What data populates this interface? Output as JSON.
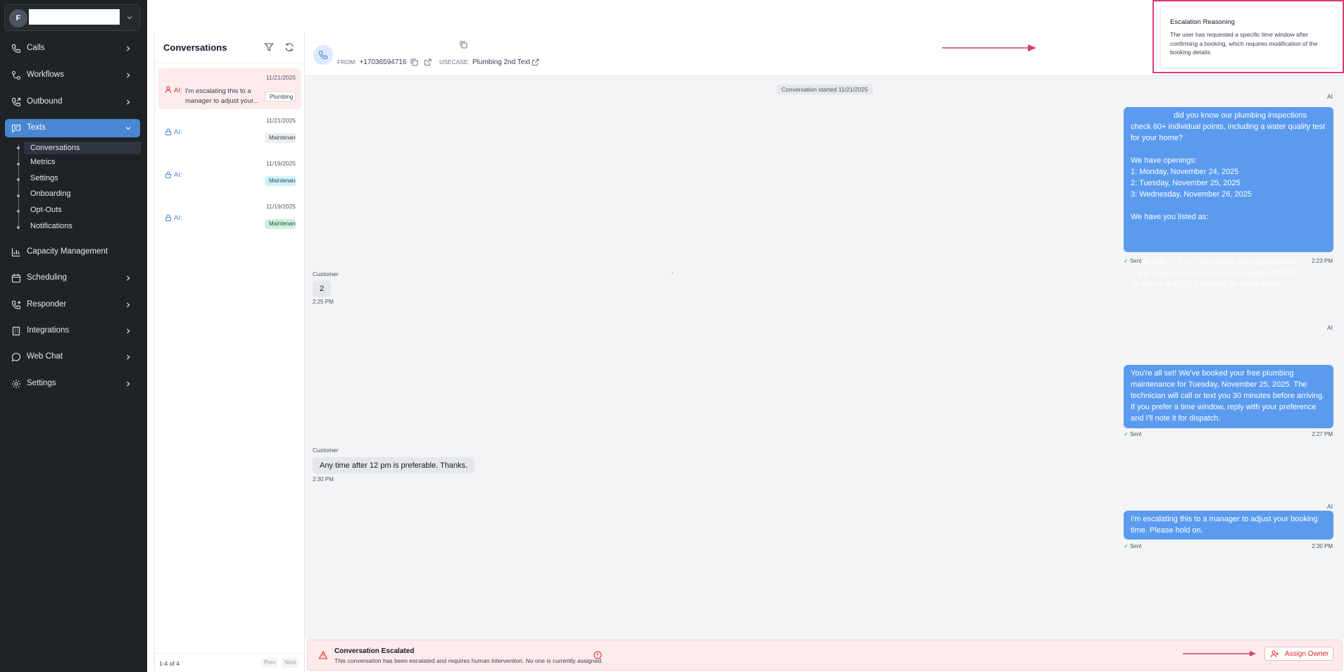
{
  "colors": {
    "sidebar_bg": "#1f2327",
    "accent": "#4a86d4",
    "ai_bubble": "#5b9bef",
    "escalation_bg": "#fdebec",
    "danger": "#dc2626",
    "annotation": "#d63b7a"
  },
  "org": {
    "initial": "F"
  },
  "nav": {
    "calls": "Calls",
    "workflows": "Workflows",
    "outbound": "Outbound",
    "texts": "Texts",
    "capacity": "Capacity Management",
    "scheduling": "Scheduling",
    "responder": "Responder",
    "integrations": "Integrations",
    "webchat": "Web Chat",
    "settings": "Settings"
  },
  "texts_sub": {
    "conversations": "Conversations",
    "metrics": "Metrics",
    "settings": "Settings",
    "onboarding": "Onboarding",
    "optouts": "Opt-Outs",
    "notifications": "Notifications"
  },
  "conversations": {
    "title": "Conversations",
    "items": [
      {
        "date": "11/21/2025",
        "ai": "AI:",
        "preview": "I'm escalating this to a manager to adjust your...",
        "tag": "Plumbing"
      },
      {
        "date": "11/21/2025",
        "ai": "AI:",
        "preview": "",
        "tag": "Maintenance"
      },
      {
        "date": "11/19/2025",
        "ai": "AI:",
        "preview": "",
        "tag": "Maintenance"
      },
      {
        "date": "11/19/2025",
        "ai": "AI:",
        "preview": "",
        "tag": "Maintenance"
      }
    ],
    "count": "1-4 of 4",
    "prev": "Prev",
    "next": "Next"
  },
  "header": {
    "from_label": "FROM:",
    "from_value": "+17036594716",
    "usecase_label": "USECASE:",
    "usecase_value": "Plumbing 2nd Text"
  },
  "chat": {
    "started": "Conversation started 11/21/2025",
    "messages": [
      {
        "sender": "AI",
        "text": "                    did you know our plumbing inspections check 60+ individual points, including a water quality test for your home?\n\nWe have openings:\n1: Monday, November 24, 2025\n2: Tuesday, November 25, 2025\n3: Wednesday, November 26, 2025\n\nWe have you listed as:\n\n\n\nReply with 1, 2, or 3 to confirm your appointment.\nIf any of your info is incorrect, just reply UPDATE.\nOr call us at (571) 240-6620 for other times.",
        "status": "Sent",
        "time": "2:23 PM"
      },
      {
        "sender": "Customer",
        "text": "2",
        "time": "2:25 PM"
      },
      {
        "sender": "AI",
        "text": "You're all set! We've booked your free plumbing maintenance for Tuesday, November 25, 2025. The technician will call or text you 30 minutes before arriving. If you prefer a time window, reply with your preference and I'll note it for dispatch.",
        "status": "Sent",
        "time": "2:27 PM"
      },
      {
        "sender": "Customer",
        "text": "Any time after 12 pm is preferable. Thanks.",
        "time": "2:30 PM"
      },
      {
        "sender": "AI",
        "text": "I'm escalating this to a manager to adjust your booking time. Please hold on.",
        "status": "Sent",
        "time": "2:30 PM"
      }
    ]
  },
  "escalation": {
    "title": "Conversation Escalated",
    "description": "This conversation has been escalated and requires human intervention. No one is currently assigned.",
    "assign_label": "Assign Owner"
  },
  "reasoning": {
    "title": "Escalation Reasoning",
    "text": "The user has requested a specific time window after confirming a booking, which requires modification of the booking details."
  }
}
